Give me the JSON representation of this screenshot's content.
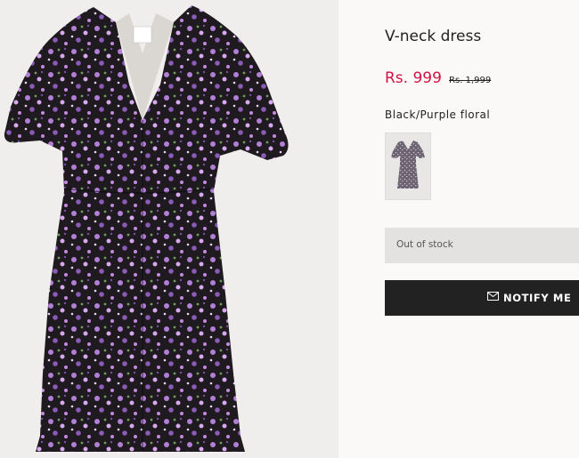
{
  "product": {
    "title": "V-neck dress",
    "price": "Rs. 999",
    "old_price": "Rs. 1,999",
    "color_name": "Black/Purple floral",
    "stock_status": "Out of stock",
    "notify_label": "NOTIFY ME"
  },
  "icons": {
    "notify": "mail-icon"
  },
  "colors": {
    "sale": "#d01345",
    "button": "#222222",
    "dress": "#1e1a1f",
    "print": "#b27fd6"
  }
}
